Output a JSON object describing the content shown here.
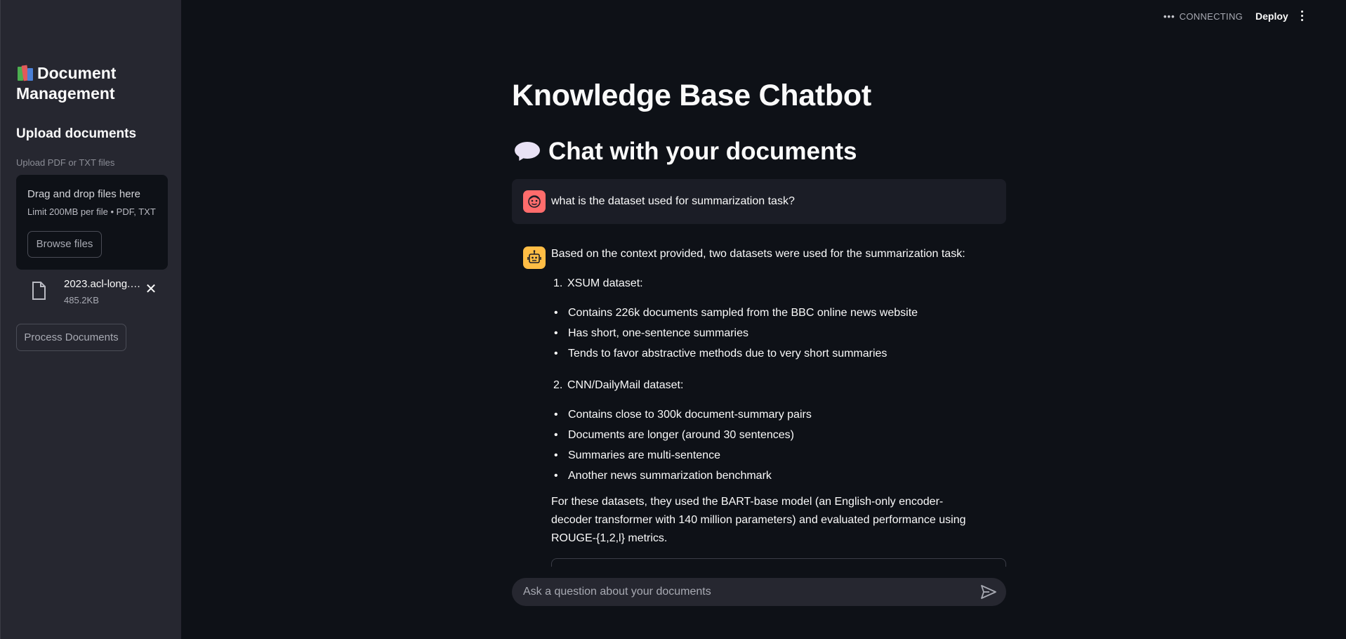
{
  "sidebar": {
    "title": "Document Management",
    "upload_heading": "Upload documents",
    "upload_label": "Upload PDF or TXT files",
    "dropzone": {
      "text": "Drag and drop files here",
      "limit": "Limit 200MB per file • PDF, TXT",
      "browse_label": "Browse files"
    },
    "file": {
      "name": "2023.acl-long.…",
      "size": "485.2KB"
    },
    "process_label": "Process Documents"
  },
  "topbar": {
    "status": "CONNECTING",
    "deploy_label": "Deploy"
  },
  "main": {
    "title": "Knowledge Base Chatbot",
    "subtitle": "Chat with your documents",
    "user_message": "what is the dataset used for summarization task?",
    "bot": {
      "intro": "Based on the context provided, two datasets were used for the summarization task:",
      "datasets": [
        {
          "number": "1.",
          "name": "XSUM dataset:",
          "points": [
            "Contains 226k documents sampled from the BBC online news website",
            "Has short, one-sentence summaries",
            "Tends to favor abstractive methods due to very short summaries"
          ]
        },
        {
          "number": "2.",
          "name": "CNN/DailyMail dataset:",
          "points": [
            "Contains close to 300k document-summary pairs",
            "Documents are longer (around 30 sentences)",
            "Summaries are multi-sentence",
            "Another news summarization benchmark"
          ]
        }
      ],
      "closing": "For these datasets, they used the BART-base model (an English-only encoder-decoder transformer with 140 million parameters) and evaluated performance using ROUGE-{1,2,l} metrics."
    },
    "chat_input_placeholder": "Ask a question about your documents"
  },
  "colors": {
    "background": "#0e1117",
    "sidebar": "#262730",
    "user_avatar": "#ff6c6c",
    "bot_avatar": "#ffbd45"
  }
}
